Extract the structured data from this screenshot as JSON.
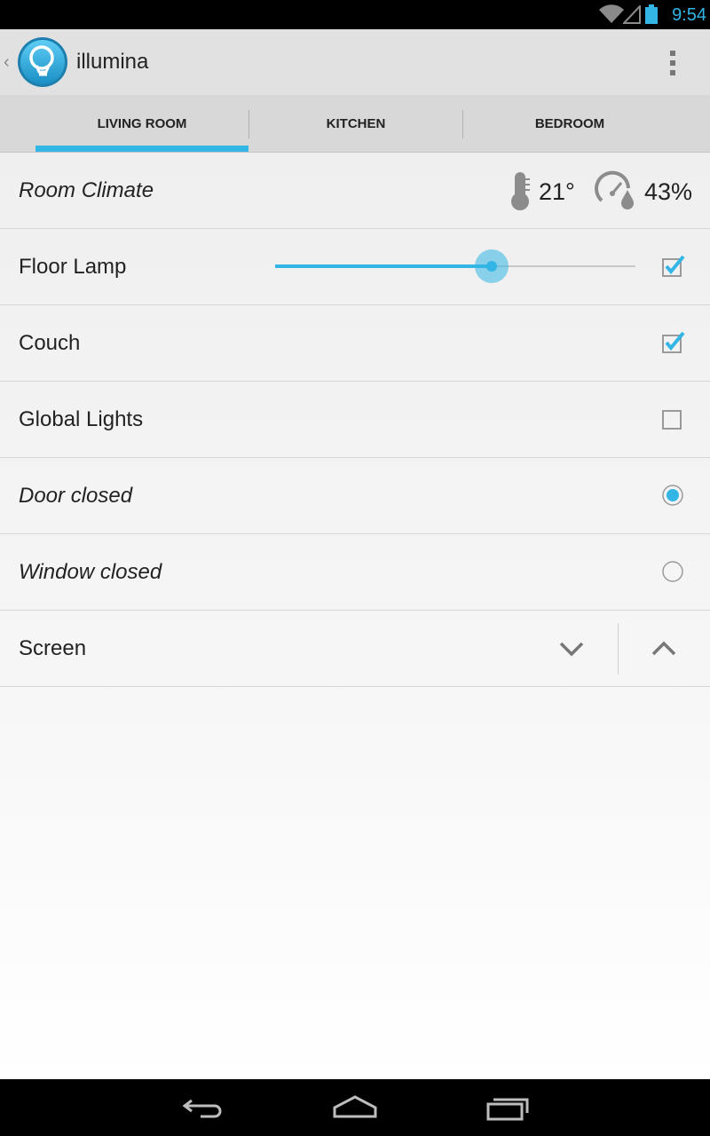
{
  "status_bar": {
    "time": "9:54",
    "icons": [
      "wifi-icon",
      "cell-signal-icon",
      "battery-icon"
    ],
    "accent_color": "#33b5e5"
  },
  "action_bar": {
    "title": "illumina",
    "app_icon": "lightbulb-icon",
    "overflow_icon": "overflow-menu-icon"
  },
  "tabs": [
    {
      "label": "LIVING ROOM",
      "selected": true
    },
    {
      "label": "KITCHEN",
      "selected": false
    },
    {
      "label": "BEDROOM",
      "selected": false
    }
  ],
  "rows": {
    "climate": {
      "label": "Room Climate",
      "temperature": "21°",
      "humidity": "43%"
    },
    "floor_lamp": {
      "label": "Floor Lamp",
      "dimmer_level_percent": 60,
      "checked": true
    },
    "couch": {
      "label": "Couch",
      "checked": true
    },
    "global_lights": {
      "label": "Global Lights",
      "checked": false
    },
    "door": {
      "label": "Door closed",
      "selected": true
    },
    "window": {
      "label": "Window closed",
      "selected": false
    },
    "screen": {
      "label": "Screen",
      "down_icon": "chevron-down-icon",
      "up_icon": "chevron-up-icon"
    }
  },
  "nav_bar": {
    "buttons": [
      "back-icon",
      "home-icon",
      "recent-apps-icon"
    ]
  }
}
